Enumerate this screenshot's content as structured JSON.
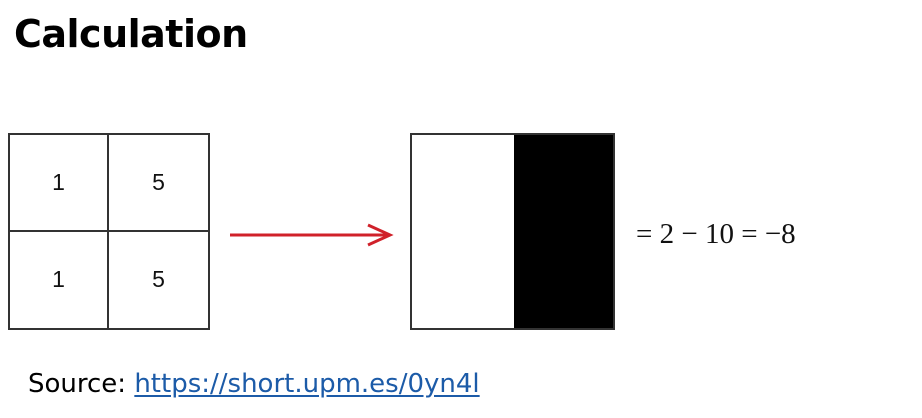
{
  "title": "Calculation",
  "input_grid": {
    "cells": [
      "1",
      "5",
      "1",
      "5"
    ]
  },
  "arrow": {
    "color": "#d0212a"
  },
  "filter": {
    "left_color": "#ffffff",
    "right_color": "#000000"
  },
  "equation": "= 2 − 10 = −8",
  "source": {
    "label": "Source:",
    "link_text": "https://short.upm.es/0yn4l",
    "link_color": "#1c5ba8"
  }
}
